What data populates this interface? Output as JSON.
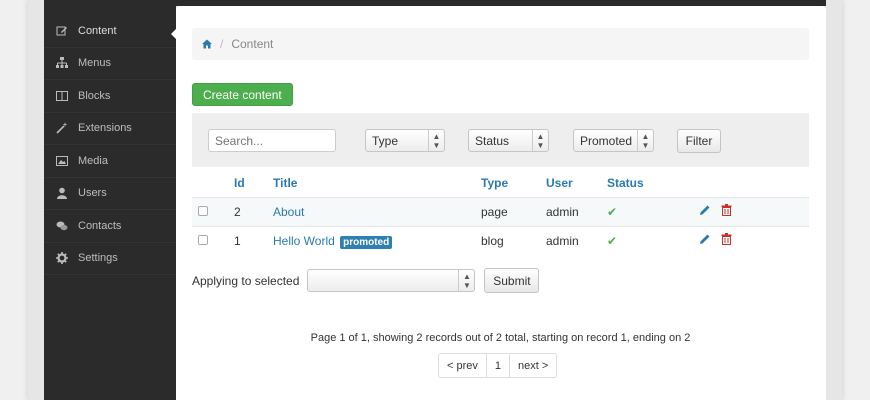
{
  "sidebar": {
    "items": [
      {
        "label": "Content",
        "icon": "edit-icon"
      },
      {
        "label": "Menus",
        "icon": "sitemap-icon"
      },
      {
        "label": "Blocks",
        "icon": "columns-icon"
      },
      {
        "label": "Extensions",
        "icon": "magic-icon"
      },
      {
        "label": "Media",
        "icon": "picture-icon"
      },
      {
        "label": "Users",
        "icon": "user-icon"
      },
      {
        "label": "Contacts",
        "icon": "comments-icon"
      },
      {
        "label": "Settings",
        "icon": "gear-icon"
      }
    ]
  },
  "breadcrumb": {
    "separator": "/",
    "current": "Content"
  },
  "toolbar": {
    "create_label": "Create content"
  },
  "filters": {
    "search_placeholder": "Search...",
    "type": "Type",
    "status": "Status",
    "promoted": "Promoted",
    "filter_label": "Filter"
  },
  "table": {
    "headers": {
      "id": "Id",
      "title": "Title",
      "type": "Type",
      "user": "User",
      "status": "Status"
    },
    "rows": [
      {
        "id": "2",
        "title": "About",
        "badge": "",
        "type": "page",
        "user": "admin",
        "status": "✔"
      },
      {
        "id": "1",
        "title": "Hello World",
        "badge": "promoted",
        "type": "blog",
        "user": "admin",
        "status": "✔"
      }
    ]
  },
  "bulk": {
    "label": "Applying to selected",
    "submit_label": "Submit"
  },
  "pagination": {
    "info": "Page 1 of 1, showing 2 records out of 2 total, starting on record 1, ending on 2",
    "prev": "< prev",
    "current": "1",
    "next": "next >"
  },
  "colors": {
    "accent": "#2a7ab0",
    "success": "#4cae4c",
    "danger": "#c9302c",
    "sidebar": "#2b2b2b"
  }
}
